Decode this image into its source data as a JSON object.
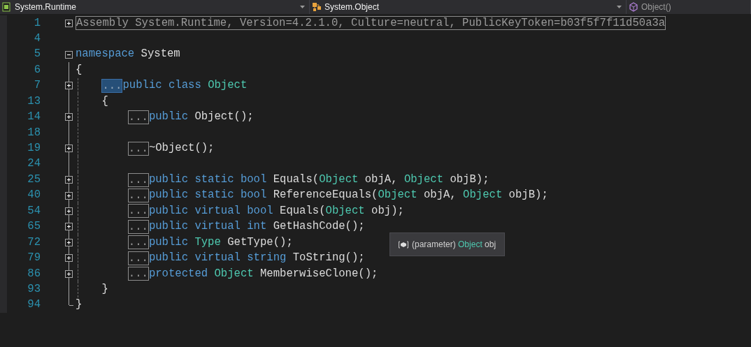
{
  "navigation_bar": [
    {
      "kind": "project",
      "text": "System.Runtime",
      "disabled": false
    },
    {
      "kind": "type",
      "text": "System.Object",
      "disabled": false
    },
    {
      "kind": "member",
      "text": "Object()",
      "disabled": true
    }
  ],
  "editor": {
    "lines": [
      {
        "number": "1",
        "expanded": false,
        "region": "Assembly System.Runtime, Version=4.2.1.0, Culture=neutral, PublicKeyToken=b03f5f7f11d50a3a"
      },
      {
        "number": "4"
      },
      {
        "number": "5",
        "expanded": true,
        "tokens": [
          {
            "kind": "keyword",
            "text": "namespace "
          },
          {
            "kind": "plain",
            "text": "System"
          }
        ]
      },
      {
        "number": "6",
        "tokens": [
          {
            "kind": "plain",
            "text": "{"
          }
        ],
        "children": [
          {
            "number": "7",
            "expanded": false,
            "collapsed": {
              "text": "...",
              "selected": true
            },
            "tokens": [
              {
                "kind": "keyword",
                "text": "public class "
              },
              {
                "kind": "type",
                "text": "Object"
              }
            ]
          },
          {
            "number": "13",
            "tokens": [
              {
                "kind": "plain",
                "text": "{"
              }
            ],
            "children": [
              {
                "number": "14",
                "expanded": false,
                "collapsed": {
                  "text": "...",
                  "selected": false
                },
                "tokens": [
                  {
                    "kind": "keyword",
                    "text": "public "
                  },
                  {
                    "kind": "plain",
                    "text": "Object();"
                  }
                ]
              },
              {
                "number": "18"
              },
              {
                "number": "19",
                "expanded": false,
                "collapsed": {
                  "text": "...",
                  "selected": false
                },
                "tokens": [
                  {
                    "kind": "plain",
                    "text": "~Object();"
                  }
                ]
              },
              {
                "number": "24"
              },
              {
                "number": "25",
                "expanded": false,
                "collapsed": {
                  "text": "...",
                  "selected": false
                },
                "tokens": [
                  {
                    "kind": "keyword",
                    "text": "public static bool "
                  },
                  {
                    "kind": "plain",
                    "text": "Equals("
                  },
                  {
                    "kind": "type",
                    "text": "Object"
                  },
                  {
                    "kind": "plain",
                    "text": " objA, "
                  },
                  {
                    "kind": "type",
                    "text": "Object"
                  },
                  {
                    "kind": "plain",
                    "text": " objB);"
                  }
                ]
              },
              {
                "number": "40",
                "expanded": false,
                "collapsed": {
                  "text": "...",
                  "selected": false
                },
                "tokens": [
                  {
                    "kind": "keyword",
                    "text": "public static bool "
                  },
                  {
                    "kind": "plain",
                    "text": "ReferenceEquals("
                  },
                  {
                    "kind": "type",
                    "text": "Object"
                  },
                  {
                    "kind": "plain",
                    "text": " objA, "
                  },
                  {
                    "kind": "type",
                    "text": "Object"
                  },
                  {
                    "kind": "plain",
                    "text": " objB);"
                  }
                ]
              },
              {
                "number": "54",
                "expanded": false,
                "collapsed": {
                  "text": "...",
                  "selected": false
                },
                "tokens": [
                  {
                    "kind": "keyword",
                    "text": "public virtual bool "
                  },
                  {
                    "kind": "plain",
                    "text": "Equals("
                  },
                  {
                    "kind": "type",
                    "text": "Object"
                  },
                  {
                    "kind": "plain",
                    "text": " obj);"
                  }
                ]
              },
              {
                "number": "65",
                "expanded": false,
                "collapsed": {
                  "text": "...",
                  "selected": false
                },
                "tokens": [
                  {
                    "kind": "keyword",
                    "text": "public virtual int "
                  },
                  {
                    "kind": "plain",
                    "text": "GetHashCode();"
                  }
                ]
              },
              {
                "number": "72",
                "expanded": false,
                "collapsed": {
                  "text": "...",
                  "selected": false
                },
                "tokens": [
                  {
                    "kind": "keyword",
                    "text": "public "
                  },
                  {
                    "kind": "type",
                    "text": "Type"
                  },
                  {
                    "kind": "plain",
                    "text": " GetType();"
                  }
                ]
              },
              {
                "number": "79",
                "expanded": false,
                "collapsed": {
                  "text": "...",
                  "selected": false
                },
                "tokens": [
                  {
                    "kind": "keyword",
                    "text": "public virtual string "
                  },
                  {
                    "kind": "plain",
                    "text": "ToString();"
                  }
                ]
              },
              {
                "number": "86",
                "expanded": false,
                "collapsed": {
                  "text": "...",
                  "selected": false
                },
                "tokens": [
                  {
                    "kind": "keyword",
                    "text": "protected "
                  },
                  {
                    "kind": "type",
                    "text": "Object"
                  },
                  {
                    "kind": "plain",
                    "text": " MemberwiseClone();"
                  }
                ]
              }
            ]
          },
          {
            "number": "93",
            "tokens": [
              {
                "kind": "plain",
                "text": "}"
              }
            ]
          }
        ]
      },
      {
        "number": "94",
        "tokens": [
          {
            "kind": "plain",
            "text": "}"
          }
        ]
      }
    ]
  },
  "tooltip": {
    "tokens": [
      {
        "kind": "plain",
        "text": "(parameter) "
      },
      {
        "kind": "type",
        "text": "Object"
      },
      {
        "kind": "plain",
        "text": " obj"
      }
    ]
  }
}
